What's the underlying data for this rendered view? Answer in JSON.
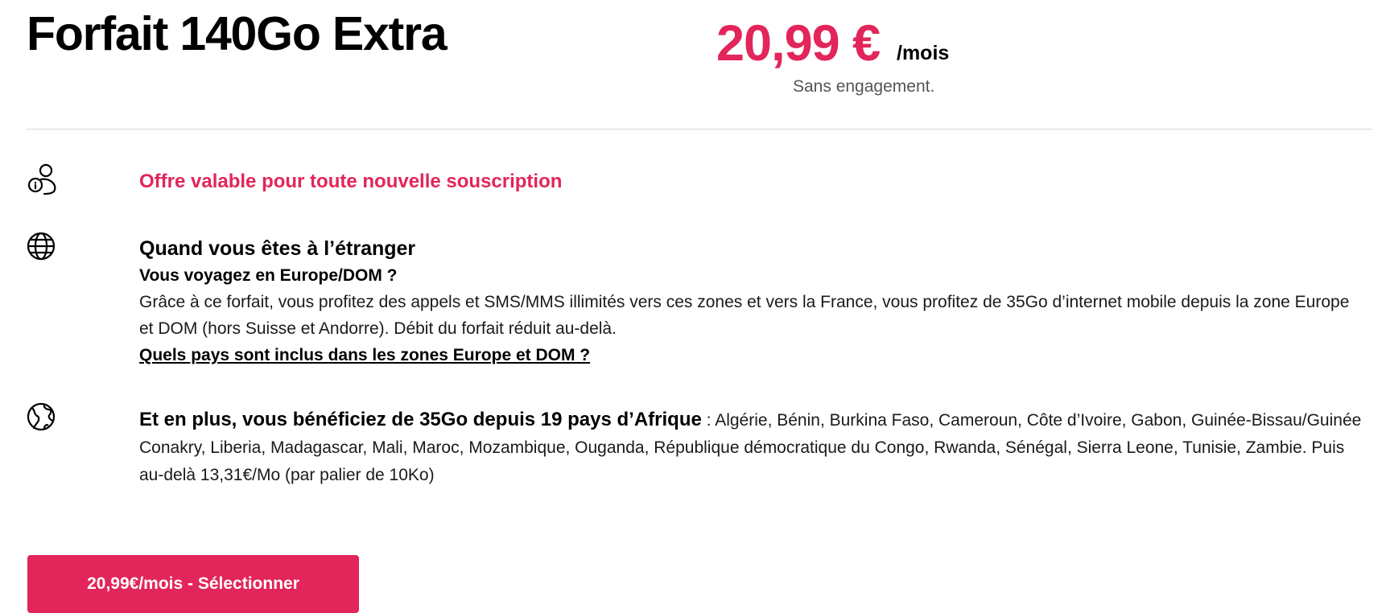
{
  "plan": {
    "title": "Forfait 140Go Extra",
    "price": "20,99 €",
    "price_unit": "/mois",
    "commitment": "Sans engagement."
  },
  "features": {
    "offer_text": "Offre valable pour toute nouvelle souscription",
    "abroad": {
      "heading": "Quand vous êtes à l’étranger",
      "subheading": "Vous voyagez en Europe/DOM ?",
      "body": "Grâce à ce forfait, vous profitez des appels et SMS/MMS illimités vers ces zones et vers la France, vous profitez de 35Go d’internet mobile depuis la zone Europe et DOM (hors Suisse et Andorre). Débit du forfait réduit au-delà.",
      "link": "Quels pays sont inclus dans les zones Europe et DOM ?"
    },
    "africa": {
      "lead": "Et en plus, vous bénéficiez de 35Go depuis 19 pays d’Afrique",
      "details": " : Algérie, Bénin, Burkina Faso, Cameroun, Côte d’Ivoire, Gabon, Guinée-Bissau/Guinée Conakry, Liberia, Madagascar, Mali, Maroc, Mozambique, Ouganda, République démocratique du Congo, Rwanda, Sénégal, Sierra Leone, Tunisie, Zambie. Puis au-delà 13,31€/Mo (par palier de 10Ko)"
    }
  },
  "cta": {
    "label": "20,99€/mois - Sélectionner"
  },
  "icons": {
    "offer": "user-info-icon",
    "abroad": "globe-icon",
    "africa": "earth-icon"
  },
  "colors": {
    "accent": "#e2255a",
    "text": "#000000",
    "muted": "#555555",
    "divider": "#d9d9d9"
  }
}
